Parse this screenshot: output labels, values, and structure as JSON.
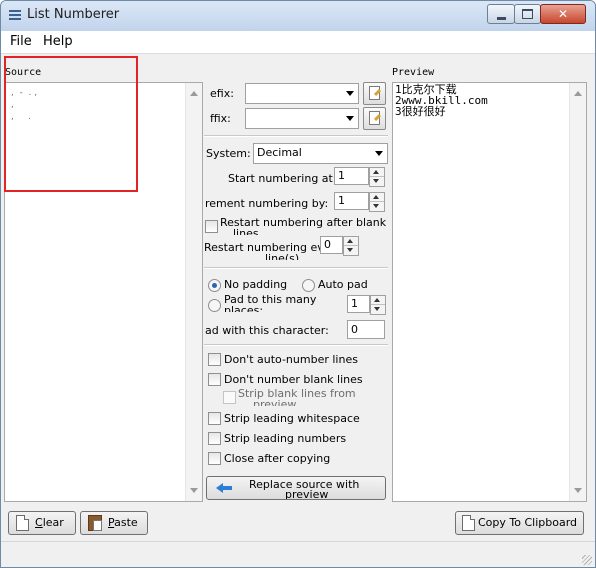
{
  "window": {
    "title": "List Numberer"
  },
  "menu": {
    "file": "File",
    "help": "Help"
  },
  "source": {
    "label": "Source"
  },
  "preview": {
    "label": "Preview",
    "lines": [
      "1比克尔下载",
      "2www.bkill.com",
      "3很好很好"
    ]
  },
  "prefix": {
    "label": "efix:",
    "value": ""
  },
  "suffix": {
    "label": "ffix:",
    "value": ""
  },
  "system": {
    "label": "System:",
    "value": "Decimal"
  },
  "start": {
    "label": "Start numbering at:",
    "value": "1"
  },
  "increment": {
    "label": "rement numbering by:",
    "value": "1"
  },
  "restart_blank": {
    "label_line1": "Restart numbering after blank",
    "label_line2": "lines"
  },
  "restart_every": {
    "label_line1": "Restart numbering ev",
    "label_line2": "line(s)",
    "value": "0"
  },
  "padding": {
    "no_padding": "No padding",
    "auto_pad": "Auto pad",
    "pad_places_line1": "Pad to this many",
    "pad_places_line2": "places:",
    "places_value": "1",
    "pad_char_label": "ad with this character:",
    "pad_char_value": "0"
  },
  "options": {
    "dont_auto_number": "Don't auto-number lines",
    "dont_number_blank": "Don't number blank lines",
    "strip_blank_line1": "Strip blank lines from",
    "strip_blank_line2": "preview",
    "strip_leading_ws": "Strip leading whitespace",
    "strip_leading_num": "Strip leading numbers",
    "close_after_copy": "Close after copying"
  },
  "buttons": {
    "replace_line1": "Replace source with",
    "replace_line2": "preview",
    "clear_first": "C",
    "clear_rest": "lear",
    "paste_first": "P",
    "paste_rest": "aste",
    "copy": "Copy To Clipboard"
  },
  "colors": {
    "highlight": "#e32424",
    "titlebar": "#c1d4ec"
  }
}
